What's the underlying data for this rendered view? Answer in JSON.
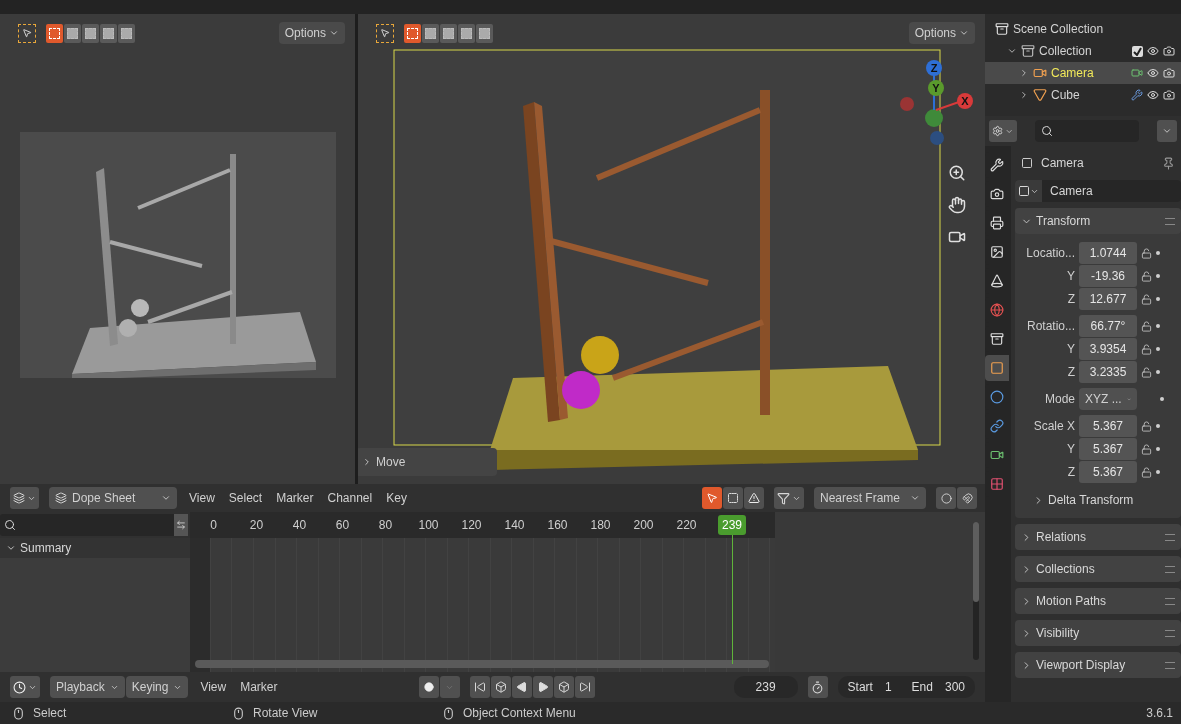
{
  "left_view": {
    "select_modes": [
      {
        "selected": true
      },
      {
        "selected": false
      },
      {
        "selected": false
      },
      {
        "selected": false
      },
      {
        "selected": false
      }
    ],
    "options": "Options"
  },
  "right_view": {
    "select_modes": [
      {
        "selected": true
      },
      {
        "selected": false
      },
      {
        "selected": false
      },
      {
        "selected": false
      },
      {
        "selected": false
      }
    ],
    "options": "Options",
    "gizmo": [
      {
        "axis": "Z",
        "color": "#2e6fd6"
      },
      {
        "axis": "Y",
        "color": "#5a9a2c"
      },
      {
        "axis": "X",
        "color": "#d83a3a"
      }
    ],
    "last_operator": "Move"
  },
  "dope_sheet": {
    "editor": "Dope Sheet",
    "menus": [
      "View",
      "Select",
      "Marker",
      "Channel",
      "Key"
    ],
    "only_selected": true,
    "snapping": "Nearest Frame",
    "ruler": [
      "0",
      "20",
      "40",
      "60",
      "80",
      "100",
      "120",
      "140",
      "160",
      "180",
      "200",
      "220"
    ],
    "current_frame": "239",
    "channels": [
      {
        "label": "Summary",
        "expanded": true
      }
    ]
  },
  "timeline": {
    "dropdowns": [
      "Playback",
      "Keying"
    ],
    "menus": [
      "View",
      "Marker"
    ],
    "frame": "239",
    "start_label": "Start",
    "start": "1",
    "end_label": "End",
    "end": "300"
  },
  "status_bar": {
    "hints": [
      "Select",
      "Rotate View",
      "Object Context Menu"
    ],
    "version": "3.6.1"
  },
  "outliner": {
    "items": [
      {
        "label": "Scene Collection",
        "kind": "scene",
        "children": [
          {
            "label": "Collection",
            "kind": "collection",
            "expanded": true,
            "checked": true,
            "selected": false,
            "children": [
              {
                "label": "Camera",
                "kind": "camera",
                "expanded": false,
                "selected": true
              },
              {
                "label": "Cube",
                "kind": "mesh",
                "expanded": false,
                "selected": false
              }
            ]
          }
        ]
      }
    ]
  },
  "properties": {
    "tabs": [
      {
        "kind": "tool",
        "selected": false
      },
      {
        "kind": "render",
        "selected": false
      },
      {
        "kind": "output",
        "selected": false
      },
      {
        "kind": "view_layer",
        "selected": false
      },
      {
        "kind": "scene",
        "selected": false
      },
      {
        "kind": "world",
        "selected": false
      },
      {
        "kind": "collection",
        "selected": false
      },
      {
        "kind": "object",
        "selected": true
      },
      {
        "kind": "physics",
        "selected": false
      },
      {
        "kind": "constraints",
        "selected": false
      },
      {
        "kind": "data",
        "selected": false
      },
      {
        "kind": "texture",
        "selected": false
      }
    ],
    "object_name": "Camera",
    "datablock": "Camera",
    "transform": {
      "title": "Transform",
      "expanded": true,
      "fields": [
        {
          "kind": "vector",
          "rows": [
            {
              "label": "Locatio...",
              "value": "1.0744"
            },
            {
              "label": "Y",
              "value": "-19.36"
            },
            {
              "label": "Z",
              "value": "12.677"
            }
          ]
        },
        {
          "kind": "vector",
          "rows": [
            {
              "label": "Rotatio...",
              "value": "66.77°"
            },
            {
              "label": "Y",
              "value": "3.9354"
            },
            {
              "label": "Z",
              "value": "3.2335"
            }
          ]
        },
        {
          "kind": "dropdown",
          "label": "Mode",
          "value": "XYZ ..."
        },
        {
          "kind": "vector",
          "rows": [
            {
              "label": "Scale X",
              "value": "5.367"
            },
            {
              "label": "Y",
              "value": "5.367"
            },
            {
              "label": "Z",
              "value": "5.367"
            }
          ]
        }
      ],
      "subpanels": [
        {
          "title": "Delta Transform",
          "expanded": false
        }
      ]
    },
    "panels": [
      {
        "title": "Relations",
        "expanded": false
      },
      {
        "title": "Collections",
        "expanded": false
      },
      {
        "title": "Motion Paths",
        "expanded": false
      },
      {
        "title": "Visibility",
        "expanded": false
      },
      {
        "title": "Viewport Display",
        "expanded": false
      }
    ]
  }
}
